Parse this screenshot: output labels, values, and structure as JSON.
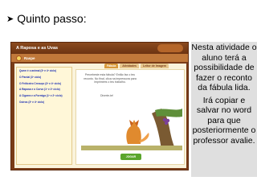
{
  "slide": {
    "heading": "Quinto passo:",
    "bullet_icon": "right-arrowhead-icon"
  },
  "app": {
    "title": "A Raposa e as Uvas",
    "nav_label": "Raspe",
    "tabs": [
      "Fábula",
      "Atividades",
      "Leitor de Imagem"
    ],
    "sidebar_items": [
      "Quem é o animal (3º e 4º ciclo)",
      "O Pardal (3º ciclo)",
      "O Feiticeiro Creouço (3º e 4º ciclo)",
      "A Raposa e o Corvo (1º e 2º ciclo)",
      "A Cigarra e a Formiga (1º e 2º ciclo)",
      "Outros (3º e 4º ciclo)"
    ],
    "content_text": "Percebeste esta fábula? Então faz o teu reconto. No final, clica na impressora para imprimires o teu trabalho.",
    "content_wish": "Diverte-te!",
    "play_button": "JOGAR"
  },
  "note": {
    "paragraph1": "Nesta atividade o aluno terá a possibilidade de fazer o reconto da fábula lida.",
    "paragraph2": "Irá copiar e salvar no word para que posteriormente o professor avalie."
  },
  "colors": {
    "app_frame": "#7a3c18",
    "nav_bar": "#c0783a",
    "link_text": "#1b2fb3",
    "note_background": "#dfdfdf",
    "play_button": "#5aa52c"
  }
}
